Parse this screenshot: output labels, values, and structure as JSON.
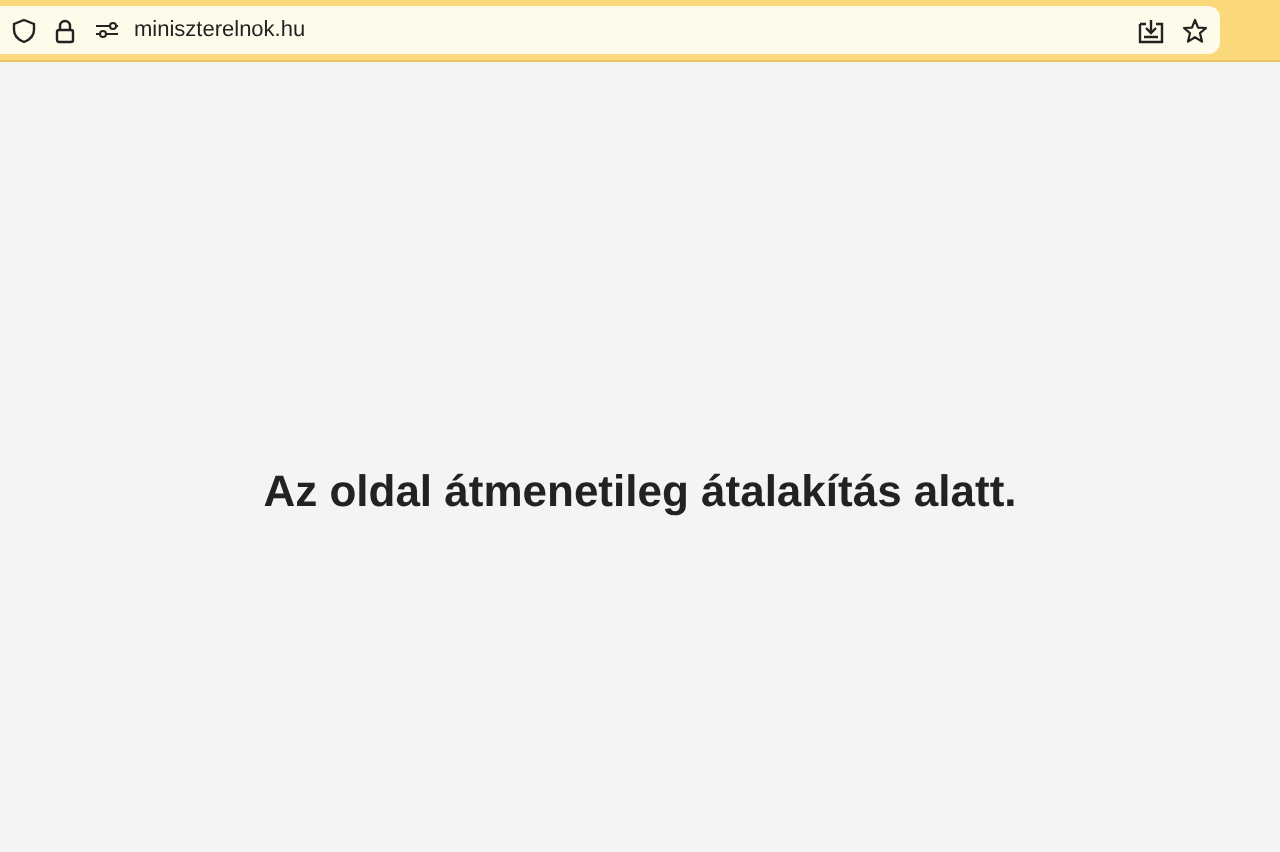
{
  "address_bar": {
    "url": "miniszterelnok.hu"
  },
  "page": {
    "message": "Az oldal átmenetileg átalakítás alatt."
  }
}
